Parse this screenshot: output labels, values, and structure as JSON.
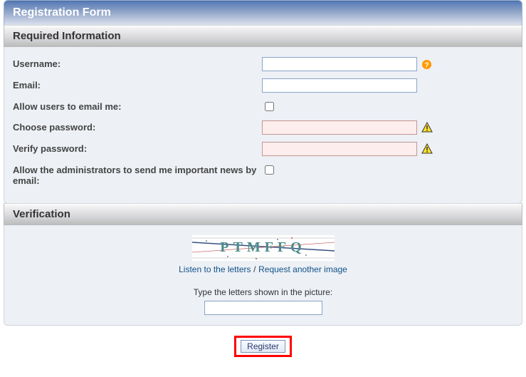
{
  "page": {
    "title": "Registration Form"
  },
  "sections": {
    "required": {
      "title": "Required Information",
      "fields": {
        "username_label": "Username:",
        "email_label": "Email:",
        "allow_email_label": "Allow users to email me:",
        "choose_pw_label": "Choose password:",
        "verify_pw_label": "Verify password:",
        "admin_news_label": "Allow the administrators to send me important news by email:"
      }
    },
    "verification": {
      "title": "Verification",
      "listen_link": "Listen to the letters",
      "separator": "/",
      "request_link": "Request another image",
      "type_label": "Type the letters shown in the picture:",
      "captcha_text": "PTMFFQ"
    }
  },
  "actions": {
    "register_label": "Register"
  },
  "icons": {
    "help": "help-icon",
    "warning": "warning-icon"
  }
}
